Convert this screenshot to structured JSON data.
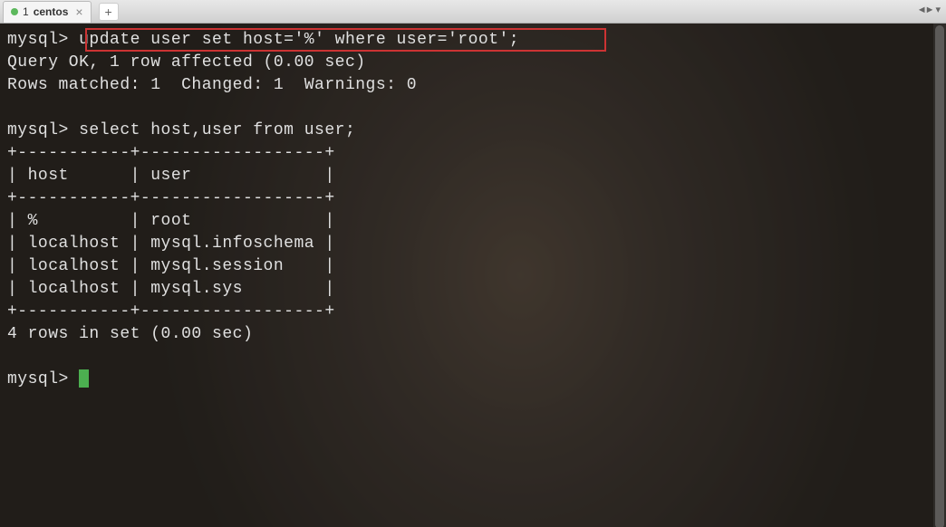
{
  "tab": {
    "number": "1",
    "title": "centos",
    "close": "×",
    "add": "+"
  },
  "menu": {
    "arrows": "◄►",
    "dropdown": "▾"
  },
  "terminal": {
    "line1_prompt": "mysql> ",
    "line1_cmd": "update user set host='%' where user='root';",
    "line2": "Query OK, 1 row affected (0.00 sec)",
    "line3": "Rows matched: 1  Changed: 1  Warnings: 0",
    "line4": "",
    "line5": "mysql> select host,user from user;",
    "line6": "+-----------+------------------+",
    "line7": "| host      | user             |",
    "line8": "+-----------+------------------+",
    "line9": "| %         | root             |",
    "line10": "| localhost | mysql.infoschema |",
    "line11": "| localhost | mysql.session    |",
    "line12": "| localhost | mysql.sys        |",
    "line13": "+-----------+------------------+",
    "line14": "4 rows in set (0.00 sec)",
    "line15": "",
    "line16": "mysql> "
  }
}
